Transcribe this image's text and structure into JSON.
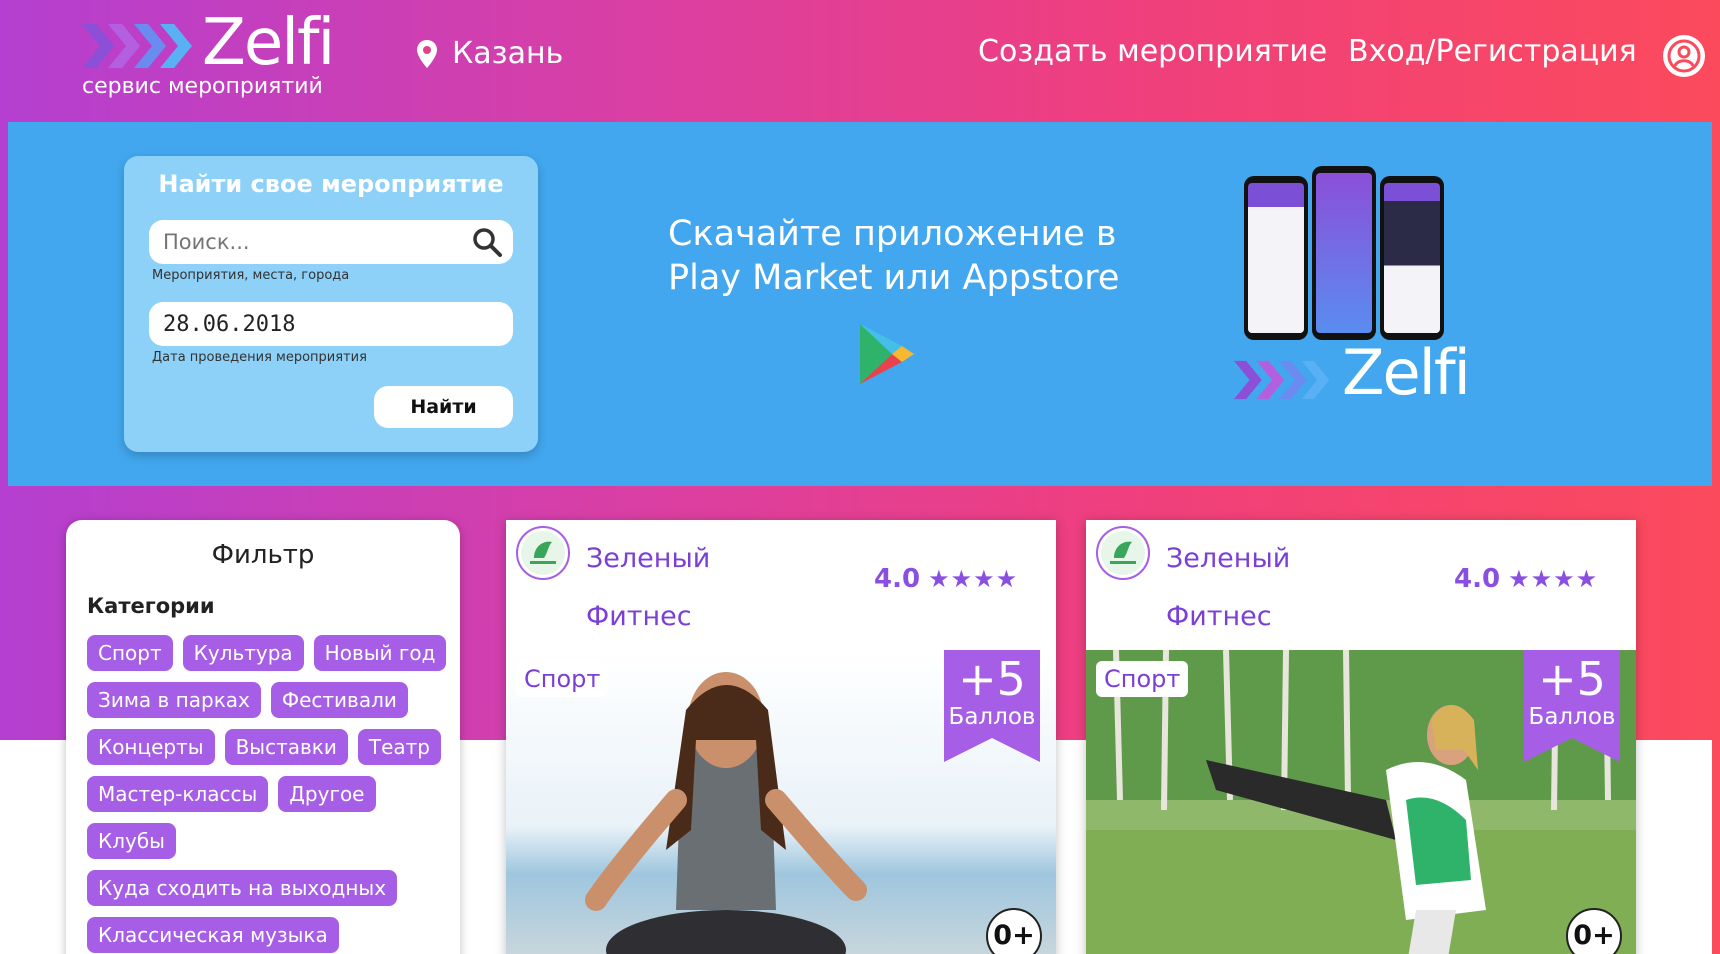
{
  "header": {
    "logo_text": "Zelfi",
    "logo_subtitle": "сервис мероприятий",
    "city": "Казань",
    "create_event": "Создать мероприятие",
    "login": "Вход/Регистрация"
  },
  "search": {
    "title": "Найти свое мероприятие",
    "query_placeholder": "Поиск...",
    "query_hint": "Мероприятия, места, города",
    "date_value": "28.06.2018",
    "date_hint": "Дата проведения мероприятия",
    "submit": "Найти"
  },
  "promo": {
    "line1": "Скачайте приложение в",
    "line2": "Play Market или Appstore",
    "brand": "Zelfi"
  },
  "filter": {
    "title": "Фильтр",
    "categories_title": "Категории",
    "categories": [
      [
        "Спорт",
        "Культура",
        "Новый год"
      ],
      [
        "Зима в парках",
        "Фестивали"
      ],
      [
        "Концерты",
        "Выставки",
        "Театр"
      ],
      [
        "Мастер-классы",
        "Другое"
      ],
      [
        "Клубы"
      ],
      [
        "Куда сходить на выходных"
      ],
      [
        "Классическая музыка"
      ]
    ]
  },
  "events": [
    {
      "name_line1": "Зеленый",
      "name_line2": "Фитнес",
      "rating": "4.0",
      "stars": "★★★★",
      "category": "Спорт",
      "points": "+5",
      "points_label": "Баллов",
      "age": "0+"
    },
    {
      "name_line1": "Зеленый",
      "name_line2": "Фитнес",
      "rating": "4.0",
      "stars": "★★★★",
      "category": "Спорт",
      "points": "+5",
      "points_label": "Баллов",
      "age": "0+"
    }
  ],
  "colors": {
    "accent_purple": "#a65ee6",
    "hero_blue": "#42a7ee",
    "gradient_start": "#b43fd0",
    "gradient_end": "#fb4a5c"
  }
}
